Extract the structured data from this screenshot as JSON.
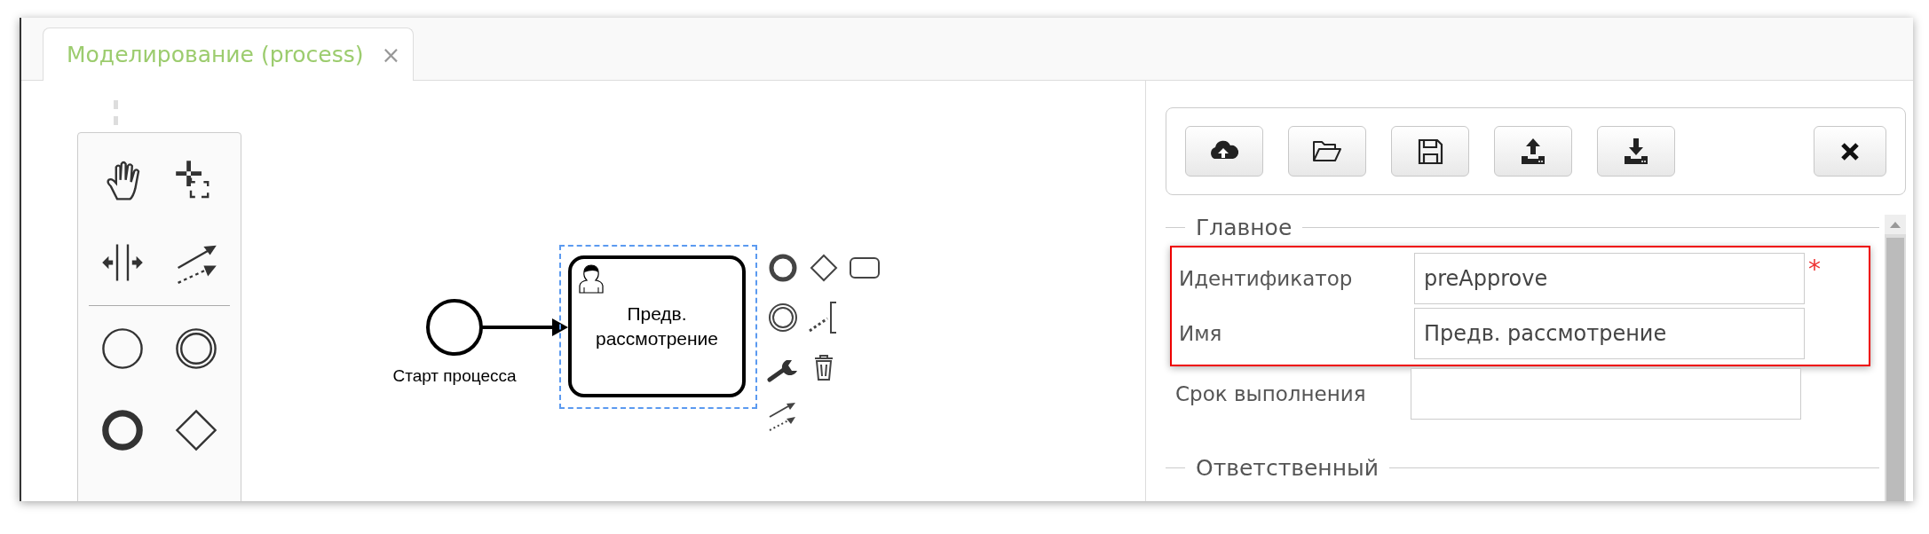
{
  "tab": {
    "title": "Моделирование (process)",
    "close": "×",
    "selected": true
  },
  "diagram": {
    "start_event": {
      "label": "Старт процесса"
    },
    "task": {
      "label": "Предв. рассмотрение",
      "selected": true
    }
  },
  "required_mark": "*",
  "sections": [
    {
      "title": "Главное",
      "fields": [
        {
          "label": "Идентификатор",
          "value": "preApprove",
          "required": true,
          "highlighted": true
        },
        {
          "label": "Имя",
          "value": "Предв. рассмотрение",
          "required": false,
          "highlighted": true
        },
        {
          "label": "Срок выполнения",
          "required": false,
          "highlighted": false
        }
      ]
    },
    {
      "title": "Ответственный"
    }
  ]
}
